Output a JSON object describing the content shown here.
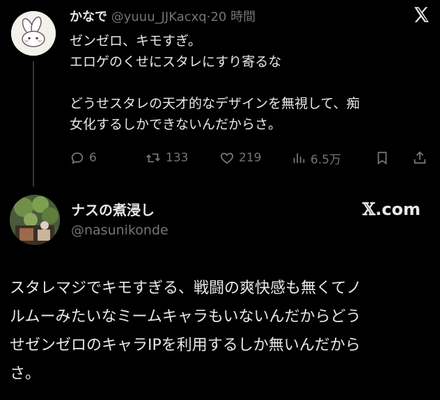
{
  "tweet": {
    "author_name": "かなで",
    "handle": "@yuuu_JJKacxq",
    "separator": "·",
    "time": "20 時間",
    "lines": [
      "ゼンゼロ、キモすぎ。",
      "エロゲのくせにスタレにすり寄るな",
      "",
      "どうせスタレの天才的なデザインを無視して、痴",
      "女化するしかできないんだからさ。"
    ],
    "actions": {
      "reply_count": "6",
      "retweet_count": "133",
      "like_count": "219",
      "view_count": "6.5万"
    }
  },
  "quoted": {
    "author_name": "ナスの煮浸し",
    "handle": "@nasunikonde",
    "brand_x": "𝕏",
    "brand_suffix": ".com",
    "lines": [
      "スタレマジでキモすぎる、戦闘の爽快感も無くてノ",
      "ルムーみたいなミームキャラもいないんだからどう",
      "せゼンゼロのキャラIPを利用するしか無いんだから",
      "さ。"
    ]
  },
  "icons": {
    "x_logo": "x-logo-icon",
    "reply": "reply-icon",
    "retweet": "retweet-icon",
    "like": "heart-icon",
    "views": "views-icon",
    "bookmark": "bookmark-icon",
    "share": "share-icon"
  },
  "colors": {
    "background": "#000000",
    "text": "#e7e9ea",
    "muted": "#71767b",
    "thread_line": "#333639"
  }
}
